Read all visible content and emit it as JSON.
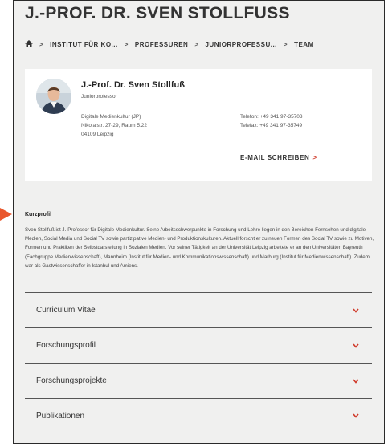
{
  "page": {
    "title": "J.-PROF. DR. SVEN STOLLFUSS"
  },
  "breadcrumb": {
    "items": [
      "INSTITUT FÜR KO...",
      "PROFESSUREN",
      "JUNIORPROFESSU...",
      "TEAM"
    ],
    "separator": ">"
  },
  "card": {
    "name": "J.-Prof. Dr. Sven Stollfuß",
    "role": "Juniorprofessor",
    "address": [
      "Digitale Medienkultur (JP)",
      "Nikolaistr. 27-29, Raum 5.22",
      "04109 Leipzig"
    ],
    "phone": "Telefon: +49 341 97-35703",
    "fax": "Telefax: +49 341 97-35749",
    "email_label": "E-MAIL SCHREIBEN",
    "email_chevron": ">"
  },
  "kurzprofil": {
    "heading": "Kurzprofil",
    "text": "Sven Stollfuß ist J.-Professor für Digitale Medienkultur. Seine Arbeitsschwerpunkte in Forschung und Lehre liegen in den Bereichen Fernsehen und digitale Medien, Social Media und Social TV sowie partizipative Medien- und Produktionskulturen. Aktuell forscht er zu neuen Formen des Social TV sowie zu Motiven, Formen und Praktiken der Selbstdarstellung in Sozialen Medien. Vor seiner Tätigkeit an der Universität Leipzig arbeitete er an den Universitäten Bayreuth (Fachgruppe Medienwissenschaft), Mannheim (Institut für Medien- und Kommunikationswissenschaft) und Marburg (Institut für Medienwissenschaft). Zudem war als Gastwissenschaffer in Istanbul und Amiens."
  },
  "accordion": [
    {
      "label": "Curriculum Vitae"
    },
    {
      "label": "Forschungsprofil"
    },
    {
      "label": "Forschungsprojekte"
    },
    {
      "label": "Publikationen"
    }
  ],
  "colors": {
    "accent": "#d03a2a",
    "marker": "#e9572d",
    "background": "#f0f0ef"
  },
  "icons": [
    "home-icon",
    "chevron-down-icon",
    "avatar-photo"
  ]
}
